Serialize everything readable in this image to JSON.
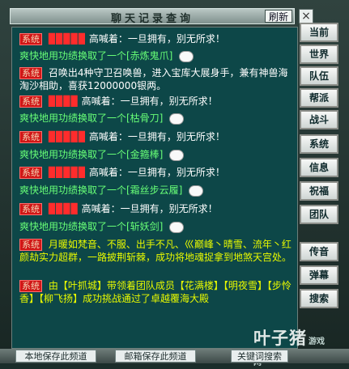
{
  "window": {
    "title": "聊天记录查询",
    "refresh": "刷新",
    "close": "×"
  },
  "messages": [
    {
      "text": "高喊着：一旦拥有，别无所求！",
      "sender": "系统"
    },
    {
      "text": "爽快地用功绩换取了一个[赤炼鬼爪]"
    },
    {
      "text": "召唤出4种守卫召唤兽，进入宝库大展身手，兼有神兽海淘沙相助，喜获12000000银两。",
      "sender": "系统"
    },
    {
      "text": "高喊着：一旦拥有，别无所求！",
      "sender": "系统"
    },
    {
      "text": "爽快地用功绩换取了一个[枯骨刀]"
    },
    {
      "text": "高喊着：一旦拥有，别无所求！",
      "sender": "系统"
    },
    {
      "text": "爽快地用功绩换取了一个[金箍棒]"
    },
    {
      "text": "高喊着：一旦拥有，别无所求！",
      "sender": "系统"
    },
    {
      "text": "爽快地用功绩换取了一个[霜丝步云履]"
    },
    {
      "text": "高喊着：一旦拥有，别无所求！",
      "sender": "系统"
    },
    {
      "text": "爽快地用功绩换取了一个[斩妖剑]"
    },
    {
      "text": "月暖如梵音、不服、出手不凡、巛巅峰丶晴雪、流年丶红颜劫实力超群，一路披荆斩棘，成功将地魂捉拿到地煞天宫处。",
      "sender": "系统"
    },
    {
      "text": "由【叶抓城】带领着团队成员【花满楼】【明夜雪】【步怜香】【柳飞扬】成功挑战通过了卓越覆海大殿",
      "sender": "系统"
    }
  ],
  "sidebar": [
    "当前",
    "世界",
    "队伍",
    "帮派",
    "战斗",
    "系统",
    "信息",
    "祝福",
    "团队",
    "传音",
    "弹幕",
    "搜索"
  ],
  "bottom": {
    "local_save": "本地保存此频道",
    "mail_save": "邮箱保存此频道",
    "keyword_search": "关键词搜索"
  },
  "brand": {
    "name": "叶子猪",
    "domain": "游戏网"
  }
}
